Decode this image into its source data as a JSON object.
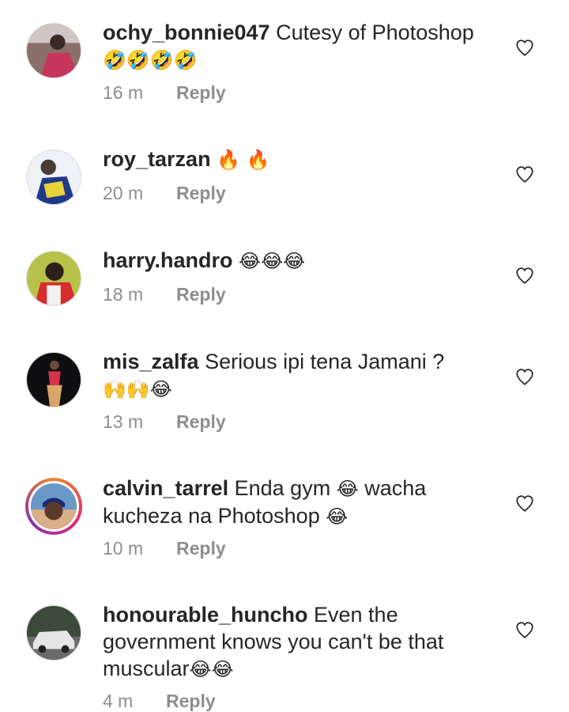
{
  "comments": [
    {
      "username": "ochy_bonnie047",
      "text": "Cutesy of Photoshop",
      "emoji": "🤣🤣🤣🤣",
      "time": "16 m",
      "reply": "Reply",
      "avatar": "avatar-photo"
    },
    {
      "username": "roy_tarzan",
      "text": "",
      "emoji": "🔥 🔥",
      "time": "20 m",
      "reply": "Reply",
      "avatar": "avatar-photo"
    },
    {
      "username": "harry.handro",
      "text": "",
      "emoji": "😂😂😂",
      "time": "18 m",
      "reply": "Reply",
      "avatar": "avatar-photo"
    },
    {
      "username": "mis_zalfa",
      "text": "Serious ipi tena Jamani ?",
      "emoji": "🙌🙌😂",
      "time": "13 m",
      "reply": "Reply",
      "avatar": "avatar-photo"
    },
    {
      "username": "calvin_tarrel",
      "text1": "Enda gym",
      "emoji1": "😂",
      "text2": "wacha kucheza na Photoshop",
      "emoji2": "😂",
      "time": "10 m",
      "reply": "Reply",
      "avatar": "avatar-photo-story-ring"
    },
    {
      "username": "honourable_huncho",
      "text": "Even the government knows you can't be that muscular",
      "emoji": "😂😂",
      "time": "4 m",
      "reply": "Reply",
      "avatar": "avatar-photo"
    }
  ],
  "icons": {
    "like": "heart-outline-icon"
  },
  "colors": {
    "text": "#262626",
    "meta": "#8e8e8e",
    "border": "#dbdbdb",
    "story_ring": [
      "#f58529",
      "#dd2a7b",
      "#8134af"
    ]
  }
}
